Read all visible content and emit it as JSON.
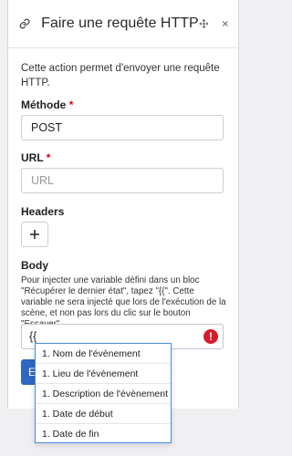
{
  "panel": {
    "title": "Faire une requête HTTP",
    "description": "Cette action permet d'envoyer une requête HTTP."
  },
  "method": {
    "label": "Méthode",
    "required_mark": "*",
    "value": "POST"
  },
  "url": {
    "label": "URL",
    "required_mark": "*",
    "placeholder": "URL"
  },
  "headers": {
    "label": "Headers",
    "add_label": "+"
  },
  "body": {
    "label": "Body",
    "help": "Pour injecter une variable défini dans un bloc \"Récupérer le dernier état\", tapez \"{{\". Cette variable ne sera injecté que lors de l'exécution de la scène, et non pas lors du clic sur le bouton \"Essayer\".",
    "value": "{{",
    "error_mark": "!"
  },
  "submit": {
    "label": "E"
  },
  "suggestions": [
    "1. Nom de l'évènement",
    "1. Lieu de l'évènement",
    "1. Description de l'évènement",
    "1. Date de début",
    "1. Date de fin"
  ]
}
